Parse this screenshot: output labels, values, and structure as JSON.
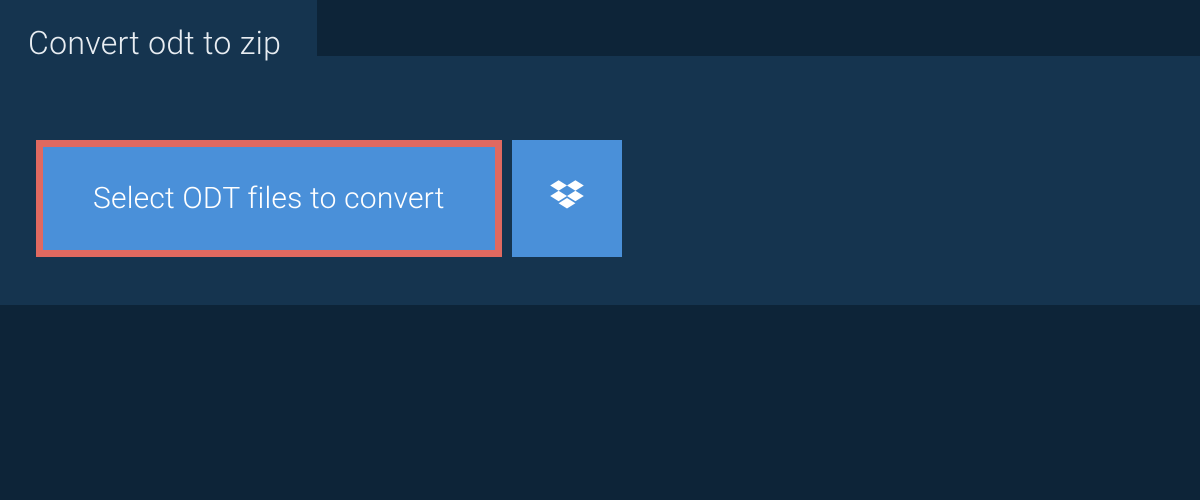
{
  "tab": {
    "title": "Convert odt to zip"
  },
  "buttons": {
    "select_label": "Select ODT files to convert"
  },
  "colors": {
    "page_bg": "#0d2438",
    "panel_bg": "#15344f",
    "button_bg": "#4a90d9",
    "highlight_border": "#e06960"
  }
}
